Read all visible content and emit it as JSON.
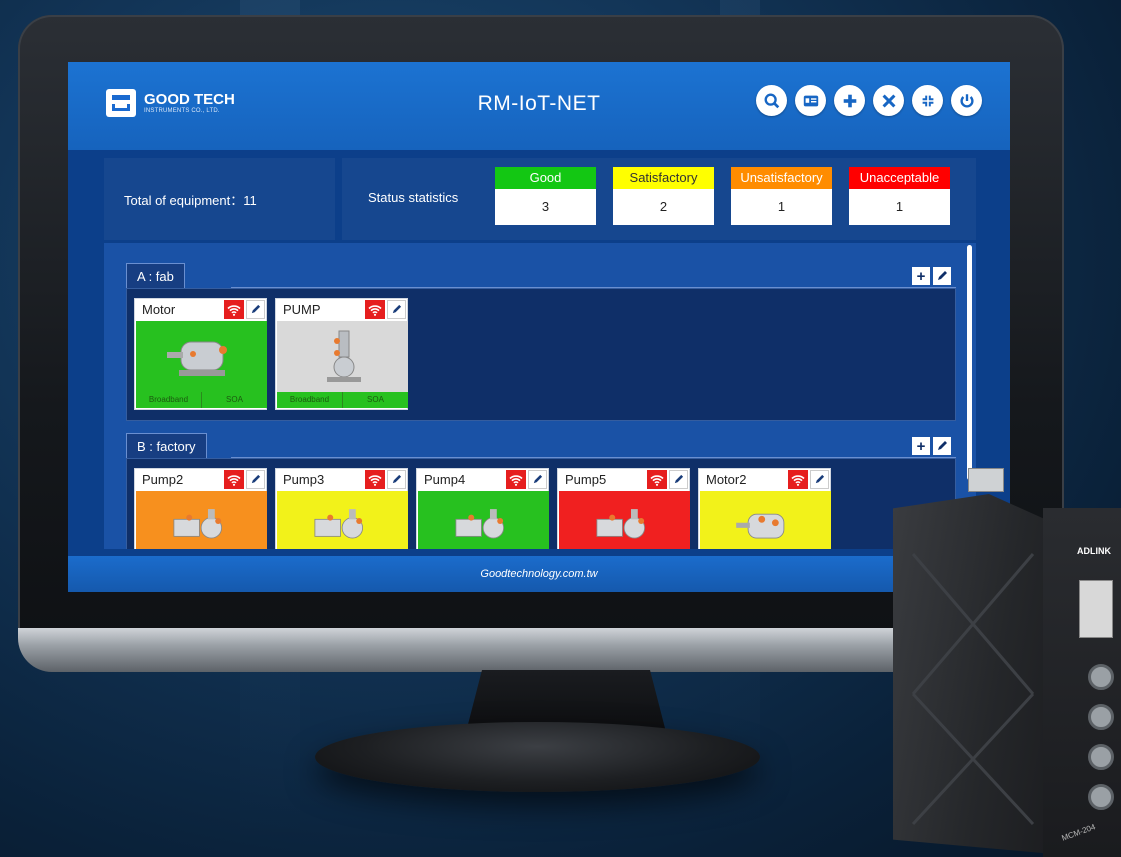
{
  "app": {
    "title": "RM-IoT-NET",
    "logo_name": "GOOD TECH",
    "logo_sub": "INSTRUMENTS CO., LTD.",
    "toolbar_icons": [
      "search-icon",
      "id-card-icon",
      "plus-icon",
      "tools-icon",
      "collapse-icon",
      "power-icon"
    ]
  },
  "summary": {
    "total_label": "Total of equipment：11",
    "status_label": "Status statistics"
  },
  "status": [
    {
      "label": "Good",
      "count": "3",
      "color": "#13c713"
    },
    {
      "label": "Satisfactory",
      "count": "2",
      "color": "#ffff00"
    },
    {
      "label": "Unsatisfactory",
      "count": "1",
      "color": "#ff8c00"
    },
    {
      "label": "Unacceptable",
      "count": "1",
      "color": "#ff0000"
    }
  ],
  "groups": [
    {
      "label": "A : fab",
      "devices": [
        {
          "name": "Motor",
          "status_color": "#27c11f",
          "foot": [
            "Broadband",
            "SOA"
          ],
          "icon": "motor-icon"
        },
        {
          "name": "PUMP",
          "status_color": "#d9d9d9",
          "foot": [
            "Broadband",
            "SOA"
          ],
          "icon": "pump-icon"
        }
      ]
    },
    {
      "label": "B : factory",
      "devices": [
        {
          "name": "Pump2",
          "status_color": "#f7901e",
          "icon": "pump-icon"
        },
        {
          "name": "Pump3",
          "status_color": "#f2f21a",
          "icon": "pump-icon"
        },
        {
          "name": "Pump4",
          "status_color": "#27c11f",
          "icon": "pump-icon"
        },
        {
          "name": "Pump5",
          "status_color": "#f02020",
          "icon": "pump-icon"
        },
        {
          "name": "Motor2",
          "status_color": "#f2f21a",
          "icon": "motor-icon"
        }
      ]
    }
  ],
  "footer": {
    "text": "Goodtechnology.com.tw"
  },
  "hardware": {
    "brand": "ADLINK",
    "model": "MCM-204"
  }
}
